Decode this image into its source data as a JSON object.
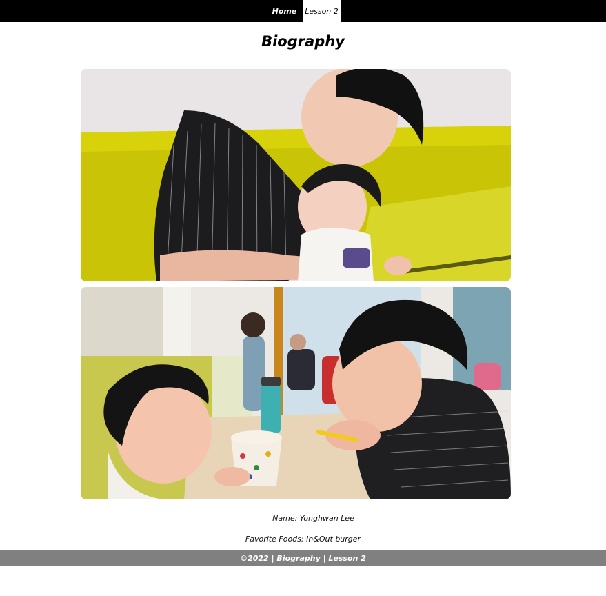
{
  "nav": {
    "items": [
      {
        "label": "Home"
      },
      {
        "label": "Lesson 2"
      }
    ]
  },
  "page": {
    "title": "Biography"
  },
  "bio": {
    "name_label": "Name: Yonghwan Lee",
    "foods_label": "Favorite Foods: In&Out burger"
  },
  "footer": {
    "text": "©2022 | Biography | Lesson 2"
  },
  "photos": [
    {
      "name": "photo-siblings-booth"
    },
    {
      "name": "photo-siblings-ice-cream"
    }
  ],
  "colors": {
    "nav_bg": "#000000",
    "footer_bg": "#808080",
    "booth_yellow": "#d8d400"
  }
}
